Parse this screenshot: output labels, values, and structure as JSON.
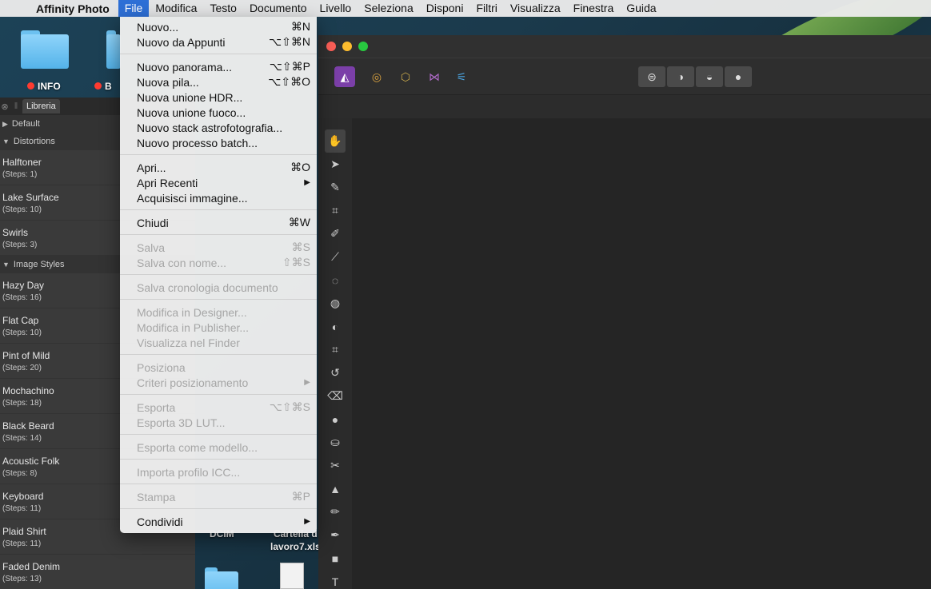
{
  "menubar": {
    "app_name": "Affinity Photo",
    "menus": [
      "File",
      "Modifica",
      "Testo",
      "Documento",
      "Livello",
      "Seleziona",
      "Disponi",
      "Filtri",
      "Visualizza",
      "Finestra",
      "Guida"
    ]
  },
  "desktop": {
    "labels": [
      "INFO",
      "B",
      "DCIM",
      "Cartella d",
      "lavoro7.xls"
    ]
  },
  "library": {
    "tab": "Libreria",
    "groups": [
      {
        "label": "Default",
        "open": false
      },
      {
        "label": "Distortions",
        "open": true
      },
      {
        "label": "Image Styles",
        "open": true
      }
    ],
    "distortions": [
      {
        "name": "Halftoner",
        "steps": "(Steps: 1)"
      },
      {
        "name": "Lake Surface",
        "steps": "(Steps: 10)"
      },
      {
        "name": "Swirls",
        "steps": "(Steps: 3)"
      }
    ],
    "styles": [
      {
        "name": "Hazy Day",
        "steps": "(Steps: 16)"
      },
      {
        "name": "Flat Cap",
        "steps": "(Steps: 10)"
      },
      {
        "name": "Pint of Mild",
        "steps": "(Steps: 20)"
      },
      {
        "name": "Mochachino",
        "steps": "(Steps: 18)"
      },
      {
        "name": "Black Beard",
        "steps": "(Steps: 14)"
      },
      {
        "name": "Acoustic Folk",
        "steps": "(Steps: 8)"
      },
      {
        "name": "Keyboard",
        "steps": "(Steps: 11)"
      },
      {
        "name": "Plaid Shirt",
        "steps": "(Steps: 11)"
      },
      {
        "name": "Faded Denim",
        "steps": "(Steps: 13)"
      }
    ]
  },
  "file_menu": {
    "items": [
      {
        "label": "Nuovo...",
        "shortcut": "⌘N",
        "enabled": true
      },
      {
        "label": "Nuovo da Appunti",
        "shortcut": "⌥⇧⌘N",
        "enabled": true
      },
      {
        "sep": true
      },
      {
        "label": "Nuovo panorama...",
        "shortcut": "⌥⇧⌘P",
        "enabled": true
      },
      {
        "label": "Nuova pila...",
        "shortcut": "⌥⇧⌘O",
        "enabled": true
      },
      {
        "label": "Nuova unione HDR...",
        "shortcut": "",
        "enabled": true
      },
      {
        "label": "Nuova unione fuoco...",
        "shortcut": "",
        "enabled": true
      },
      {
        "label": "Nuovo stack astrofotografia...",
        "shortcut": "",
        "enabled": true
      },
      {
        "label": "Nuovo processo batch...",
        "shortcut": "",
        "enabled": true
      },
      {
        "sep": true
      },
      {
        "label": "Apri...",
        "shortcut": "⌘O",
        "enabled": true
      },
      {
        "label": "Apri Recenti",
        "shortcut": "▶",
        "enabled": true
      },
      {
        "label": "Acquisisci immagine...",
        "shortcut": "",
        "enabled": true
      },
      {
        "sep": true
      },
      {
        "label": "Chiudi",
        "shortcut": "⌘W",
        "enabled": true
      },
      {
        "sep": true
      },
      {
        "label": "Salva",
        "shortcut": "⌘S",
        "enabled": false
      },
      {
        "label": "Salva con nome...",
        "shortcut": "⇧⌘S",
        "enabled": false
      },
      {
        "sep": true
      },
      {
        "label": "Salva cronologia documento",
        "shortcut": "",
        "enabled": false
      },
      {
        "sep": true
      },
      {
        "label": "Modifica in Designer...",
        "shortcut": "",
        "enabled": false
      },
      {
        "label": "Modifica in Publisher...",
        "shortcut": "",
        "enabled": false
      },
      {
        "label": "Visualizza nel Finder",
        "shortcut": "",
        "enabled": false
      },
      {
        "sep": true
      },
      {
        "label": "Posiziona",
        "shortcut": "",
        "enabled": false
      },
      {
        "label": "Criteri posizionamento",
        "shortcut": "▶",
        "enabled": false
      },
      {
        "sep": true
      },
      {
        "label": "Esporta",
        "shortcut": "⌥⇧⌘S",
        "enabled": false
      },
      {
        "label": "Esporta 3D LUT...",
        "shortcut": "",
        "enabled": false
      },
      {
        "sep": true
      },
      {
        "label": "Esporta come modello...",
        "shortcut": "",
        "enabled": false
      },
      {
        "sep": true
      },
      {
        "label": "Importa profilo ICC...",
        "shortcut": "",
        "enabled": false
      },
      {
        "sep": true
      },
      {
        "label": "Stampa",
        "shortcut": "⌘P",
        "enabled": false
      },
      {
        "sep": true
      },
      {
        "label": "Condividi",
        "shortcut": "▶",
        "enabled": true
      }
    ]
  },
  "toolbar": {
    "tools": [
      "✋",
      "➤",
      "✎",
      "⌗",
      "✐",
      "⟋",
      "◌",
      "◍",
      "◐",
      "⌗",
      "↺",
      "⌫",
      "●",
      "⛀",
      "✂",
      "▲",
      "✏",
      "✒",
      "■",
      "T"
    ]
  }
}
